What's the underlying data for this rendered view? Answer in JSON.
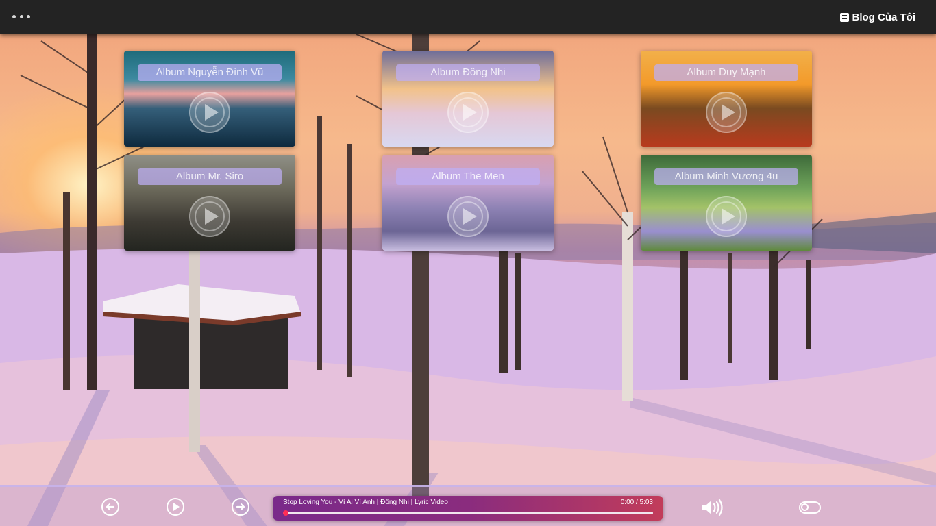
{
  "header": {
    "menu_icon": "more-dots-icon",
    "blog_label": "Blog Của Tôi",
    "blog_icon": "blogger-icon"
  },
  "albums": [
    {
      "title": "Album Nguyễn Đình Vũ"
    },
    {
      "title": "Album Đông Nhi"
    },
    {
      "title": "Album Duy Mạnh"
    },
    {
      "title": "Album Mr. Siro"
    },
    {
      "title": "Album The Men"
    },
    {
      "title": "Album Minh Vương 4u"
    }
  ],
  "player": {
    "track_title": "Stop Loving You - Vì Ai Vì Anh | Đông Nhi | Lyric Video",
    "time": "0:00 / 5:03",
    "progress": 0.0,
    "accent": "#ff2d55",
    "prev_icon": "arrow-left-icon",
    "play_icon": "play-icon",
    "next_icon": "arrow-right-icon",
    "volume_icon": "volume-high-icon",
    "toggle_icon": "toggle-icon"
  }
}
